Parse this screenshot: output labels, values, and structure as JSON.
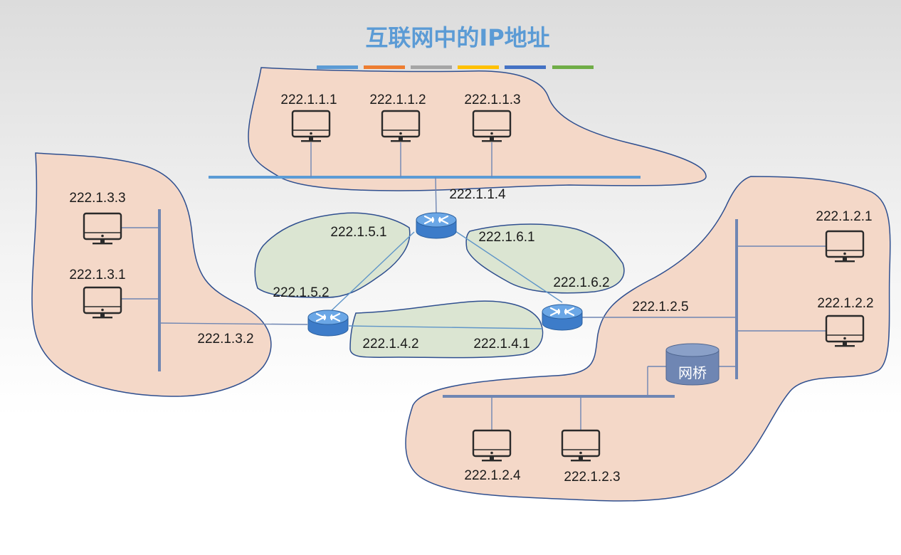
{
  "title": "互联网中的IP地址",
  "title_bar_colors": [
    "#5b9bd5",
    "#ed7d31",
    "#a5a5a5",
    "#ffc000",
    "#4472c4",
    "#70ad47"
  ],
  "labels": {
    "h_1_1_1": "222.1.1.1",
    "h_1_1_2": "222.1.1.2",
    "h_1_1_3": "222.1.1.3",
    "r_1_1_4": "222.1.1.4",
    "h_1_3_3": "222.1.3.3",
    "h_1_3_1": "222.1.3.1",
    "r_1_3_2": "222.1.3.2",
    "r_1_5_1": "222.1.5.1",
    "r_1_5_2": "222.1.5.2",
    "r_1_6_1": "222.1.6.1",
    "r_1_6_2": "222.1.6.2",
    "r_1_4_2": "222.1.4.2",
    "r_1_4_1": "222.1.4.1",
    "r_1_2_5": "222.1.2.5",
    "h_1_2_1": "222.1.2.1",
    "h_1_2_2": "222.1.2.2",
    "h_1_2_4": "222.1.2.4",
    "h_1_2_3": "222.1.2.3",
    "bridge": "网桥"
  },
  "icons": {
    "host": "computer-monitor-icon",
    "router": "router-icon",
    "bridge": "bridge-cylinder-icon"
  }
}
